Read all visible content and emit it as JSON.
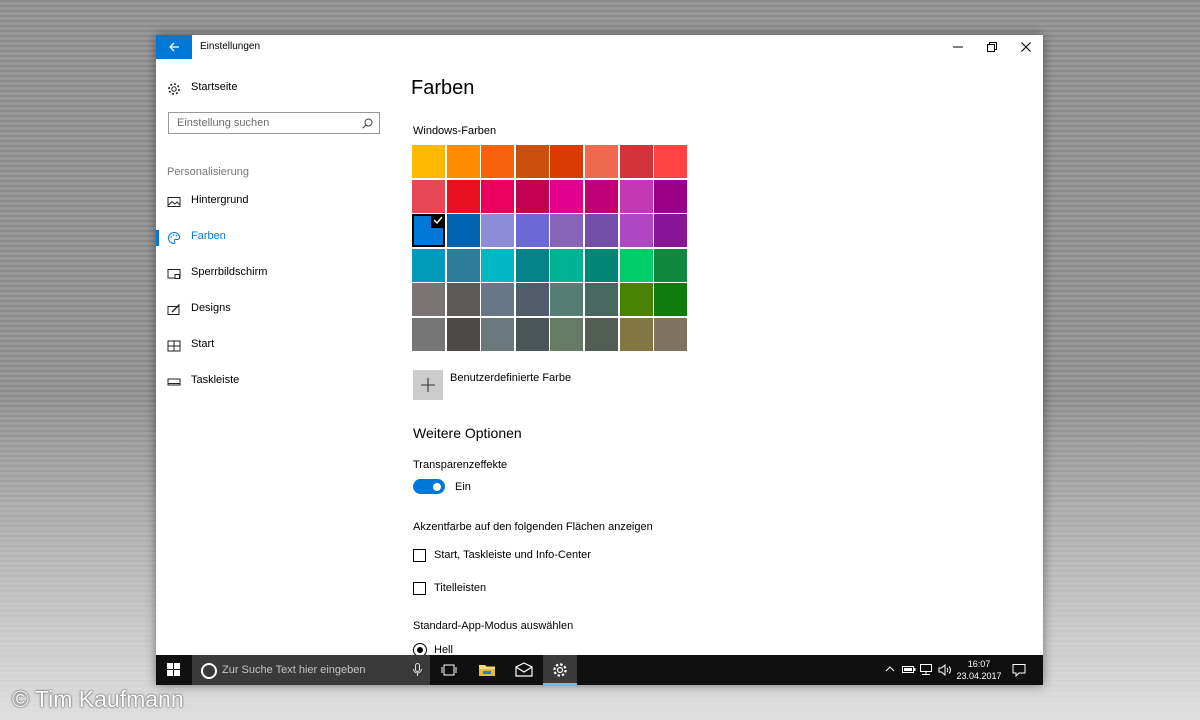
{
  "window": {
    "title": "Einstellungen"
  },
  "sidebar": {
    "home_label": "Startseite",
    "search_placeholder": "Einstellung suchen",
    "section_label": "Personalisierung",
    "items": [
      {
        "label": "Hintergrund",
        "icon": "image-icon",
        "active": false
      },
      {
        "label": "Farben",
        "icon": "palette-icon",
        "active": true
      },
      {
        "label": "Sperrbildschirm",
        "icon": "lockscreen-icon",
        "active": false
      },
      {
        "label": "Designs",
        "icon": "designs-icon",
        "active": false
      },
      {
        "label": "Start",
        "icon": "start-icon",
        "active": false
      },
      {
        "label": "Taskleiste",
        "icon": "taskbar-icon",
        "active": false
      }
    ]
  },
  "main": {
    "title": "Farben",
    "windows_colors_label": "Windows-Farben",
    "selected_color": "#0078D7",
    "colors": [
      [
        "#FFB900",
        "#FF8C00",
        "#F7630C",
        "#CA5010",
        "#DA3B01",
        "#EF6950",
        "#D13438",
        "#FF4343"
      ],
      [
        "#E74856",
        "#E81123",
        "#EA005E",
        "#C30052",
        "#E3008C",
        "#BF0077",
        "#C239B3",
        "#9A0089"
      ],
      [
        "#0078D7",
        "#0063B1",
        "#8E8CD8",
        "#6B69D6",
        "#8764B8",
        "#744DA9",
        "#B146C2",
        "#881798"
      ],
      [
        "#0099BC",
        "#2D7D9A",
        "#00B7C3",
        "#038387",
        "#00B294",
        "#018574",
        "#00CC6A",
        "#10893E"
      ],
      [
        "#7A7574",
        "#5D5A58",
        "#68768A",
        "#515C6B",
        "#567C73",
        "#486860",
        "#498205",
        "#107C10"
      ],
      [
        "#767676",
        "#4C4A48",
        "#69797E",
        "#4A5459",
        "#647C64",
        "#525E54",
        "#847545",
        "#7E735F"
      ]
    ],
    "custom_color_label": "Benutzerdefinierte Farbe",
    "more_options_heading": "Weitere Optionen",
    "transparency_label": "Transparenzeffekte",
    "transparency_state": "Ein",
    "accent_surfaces_label": "Akzentfarbe auf den folgenden Flächen anzeigen",
    "checkbox_start": "Start, Taskleiste und Info-Center",
    "checkbox_titlebars": "Titelleisten",
    "app_mode_label": "Standard-App-Modus auswählen",
    "app_mode_option": "Hell"
  },
  "taskbar": {
    "search_placeholder": "Zur Suche Text hier eingeben",
    "time": "16:07",
    "date": "23.04.2017"
  },
  "watermark": "© Tim Kaufmann"
}
